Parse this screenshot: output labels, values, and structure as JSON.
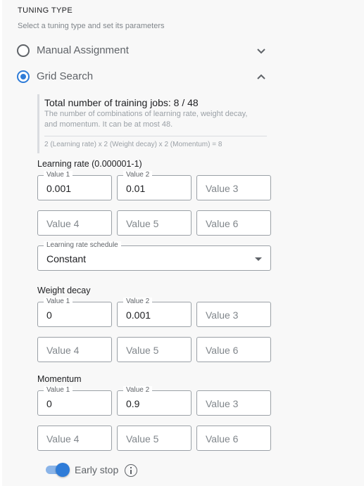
{
  "section": {
    "heading": "TUNING TYPE",
    "subheading": "Select a tuning type and set its parameters"
  },
  "options": {
    "manual": {
      "label": "Manual Assignment",
      "selected": false
    },
    "grid": {
      "label": "Grid Search",
      "selected": true
    }
  },
  "summary": {
    "title": "Total number of training jobs: 8 / 48",
    "description_line1": "The number of combinations of learning rate, weight decay,",
    "description_line2": "and momentum. It can be at most 48.",
    "formula": "2 (Learning rate) x 2 (Weight decay) x 2 (Momentum) = 8"
  },
  "learning_rate": {
    "label": "Learning rate (0.000001-1)",
    "fields": [
      {
        "label": "Value 1",
        "value": "0.001",
        "placeholder": ""
      },
      {
        "label": "Value 2",
        "value": "0.01",
        "placeholder": ""
      },
      {
        "label": "",
        "value": "",
        "placeholder": "Value 3"
      },
      {
        "label": "",
        "value": "",
        "placeholder": "Value 4"
      },
      {
        "label": "",
        "value": "",
        "placeholder": "Value 5"
      },
      {
        "label": "",
        "value": "",
        "placeholder": "Value 6"
      }
    ],
    "schedule": {
      "label": "Learning rate schedule",
      "value": "Constant"
    }
  },
  "weight_decay": {
    "label": "Weight decay",
    "fields": [
      {
        "label": "Value 1",
        "value": "0",
        "placeholder": ""
      },
      {
        "label": "Value 2",
        "value": "0.001",
        "placeholder": ""
      },
      {
        "label": "",
        "value": "",
        "placeholder": "Value 3"
      },
      {
        "label": "",
        "value": "",
        "placeholder": "Value 4"
      },
      {
        "label": "",
        "value": "",
        "placeholder": "Value 5"
      },
      {
        "label": "",
        "value": "",
        "placeholder": "Value 6"
      }
    ]
  },
  "momentum": {
    "label": "Momentum",
    "fields": [
      {
        "label": "Value 1",
        "value": "0",
        "placeholder": ""
      },
      {
        "label": "Value 2",
        "value": "0.9",
        "placeholder": ""
      },
      {
        "label": "",
        "value": "",
        "placeholder": "Value 3"
      },
      {
        "label": "",
        "value": "",
        "placeholder": "Value 4"
      },
      {
        "label": "",
        "value": "",
        "placeholder": "Value 5"
      },
      {
        "label": "",
        "value": "",
        "placeholder": "Value 6"
      }
    ]
  },
  "early_stop": {
    "label": "Early stop",
    "enabled": true
  },
  "colors": {
    "accent": "#2f7cd8",
    "accent_light": "#8ab4e8",
    "border": "#9aa0a6",
    "background": "#f8f8f8"
  },
  "icons": {
    "manual_expand": "chevron-down-icon",
    "grid_collapse": "chevron-up-icon",
    "early_stop_info": "info-icon",
    "schedule_dropdown": "dropdown-arrow-icon"
  }
}
